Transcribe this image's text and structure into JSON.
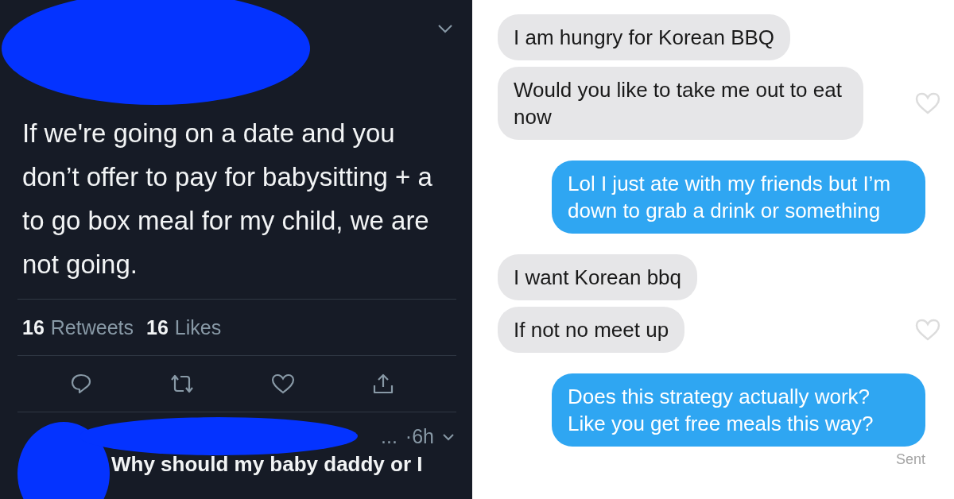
{
  "tweet": {
    "text": "If we're going on a date and you don’t offer to pay for babysitting + a to go box meal for my child, we are not going.",
    "stats": [
      {
        "count": "16",
        "label": "Retweets"
      },
      {
        "count": "16",
        "label": "Likes"
      }
    ]
  },
  "reply": {
    "name_end": "...",
    "time": "·6h",
    "text": "Why should my baby daddy or I"
  },
  "messages": [
    {
      "kind": "received",
      "text": "I am hungry for Korean BBQ",
      "heart": false
    },
    {
      "kind": "received",
      "text": "Would you like to take me out to eat now",
      "heart": true
    },
    {
      "kind": "sent",
      "text": "Lol I just ate with my friends but I’m down to grab a drink or something",
      "heart": false
    },
    {
      "kind": "received",
      "text": "I want Korean bbq",
      "heart": false
    },
    {
      "kind": "received",
      "text": "If not no meet up",
      "heart": true
    },
    {
      "kind": "sent",
      "text": "Does this strategy actually work? Like you get free meals this way?",
      "heart": false
    }
  ],
  "status": "Sent"
}
